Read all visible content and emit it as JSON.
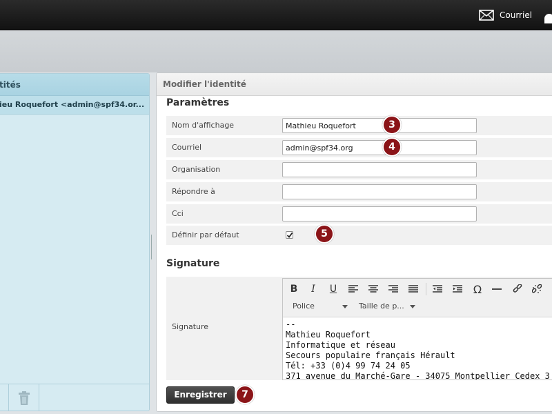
{
  "topbar": {
    "mail_label": "Courriel",
    "mail_icon": "envelope-icon",
    "extra_icon": "user-icon"
  },
  "left_panel": {
    "title": "tités",
    "identities": [
      {
        "label": "ieu Roquefort <admin@spf34.or..."
      }
    ],
    "footer_icon": "trash-icon"
  },
  "right_panel": {
    "title": "Modifier l'identité",
    "settings_title": "Paramètres",
    "fields": {
      "display_name": {
        "label": "Nom d'affichage",
        "value": "Mathieu Roquefort"
      },
      "email": {
        "label": "Courriel",
        "value": "admin@spf34.org"
      },
      "organisation": {
        "label": "Organisation",
        "value": ""
      },
      "reply_to": {
        "label": "Répondre à",
        "value": ""
      },
      "bcc": {
        "label": "Cci",
        "value": ""
      },
      "default": {
        "label": "Définir par défaut",
        "checked": true
      }
    },
    "signature_title": "Signature",
    "signature_label": "Signature",
    "editor": {
      "toolbar_icons": [
        "bold-icon",
        "italic-icon",
        "underline-icon",
        "align-left-icon",
        "align-center-icon",
        "align-right-icon",
        "align-justify-icon",
        "outdent-icon",
        "indent-icon",
        "omega-icon",
        "horizontal-rule-icon",
        "link-icon",
        "unlink-icon"
      ],
      "font_label": "Police",
      "size_label": "Taille de p...",
      "content": "--\nMathieu Roquefort\nInformatique et réseau\nSecours populaire français Hérault\nTél: +33 (0)4 99 74 24 05\n371 avenue du Marché-Gare - 34075 Montpellier Cedex 3"
    },
    "save_label": "Enregistrer"
  },
  "callouts": [
    "3",
    "4",
    "5",
    "7"
  ],
  "colors": {
    "callout": "#8b1418",
    "topbar": "#1a1a1a",
    "left_panel": "#d6ebf2"
  }
}
